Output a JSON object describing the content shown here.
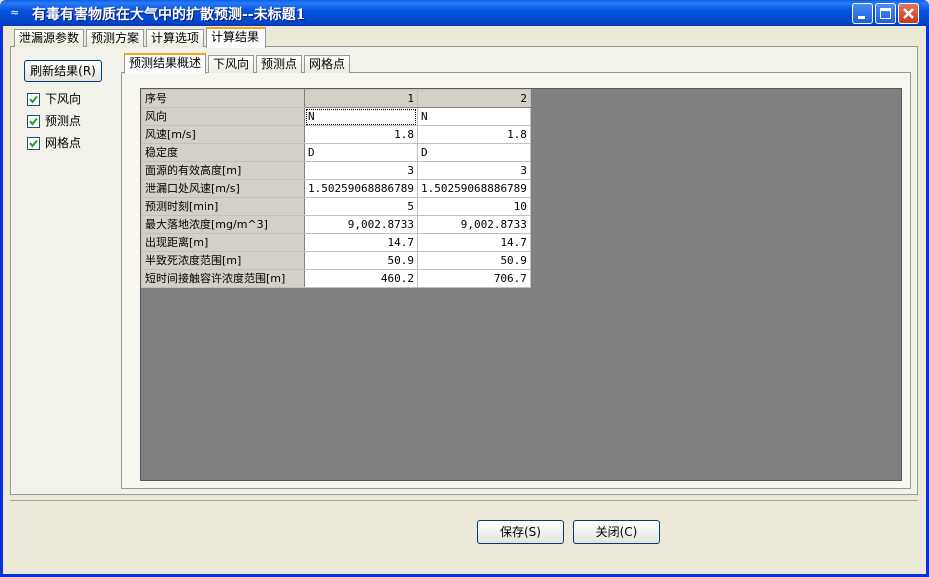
{
  "window": {
    "title": "有毒有害物质在大气中的扩散预测--未标题1"
  },
  "main_tabs": [
    {
      "label": "泄漏源参数"
    },
    {
      "label": "预测方案"
    },
    {
      "label": "计算选项"
    },
    {
      "label": "计算结果"
    }
  ],
  "left": {
    "refresh_label": "刷新结果(R)",
    "checkboxes": [
      {
        "label": "下风向",
        "checked": true
      },
      {
        "label": "预测点",
        "checked": true
      },
      {
        "label": "网格点",
        "checked": true
      }
    ]
  },
  "sub_tabs": [
    {
      "label": "预测结果概述"
    },
    {
      "label": "下风向"
    },
    {
      "label": "预测点"
    },
    {
      "label": "网格点"
    }
  ],
  "grid": {
    "header": {
      "label": "序号",
      "cols": [
        "1",
        "2"
      ]
    },
    "rows": [
      {
        "label": "风向",
        "values": [
          "N",
          "N"
        ]
      },
      {
        "label": "风速[m/s]",
        "values": [
          "1.8",
          "1.8"
        ]
      },
      {
        "label": "稳定度",
        "values": [
          "D",
          "D"
        ]
      },
      {
        "label": "面源的有效高度[m]",
        "values": [
          "3",
          "3"
        ]
      },
      {
        "label": "泄漏口处风速[m/s]",
        "values": [
          "1.50259068886789",
          "1.50259068886789"
        ]
      },
      {
        "label": "预测时刻[min]",
        "values": [
          "5",
          "10"
        ]
      },
      {
        "label": "最大落地浓度[mg/m^3]",
        "values": [
          "9,002.8733",
          "9,002.8733"
        ]
      },
      {
        "label": "出现距离[m]",
        "values": [
          "14.7",
          "14.7"
        ]
      },
      {
        "label": "半致死浓度范围[m]",
        "values": [
          "50.9",
          "50.9"
        ]
      },
      {
        "label": "短时间接触容许浓度范围[m]",
        "values": [
          "460.2",
          "706.7"
        ]
      }
    ]
  },
  "footer": {
    "save_label": "保存(S)",
    "close_label": "关闭(C)"
  }
}
